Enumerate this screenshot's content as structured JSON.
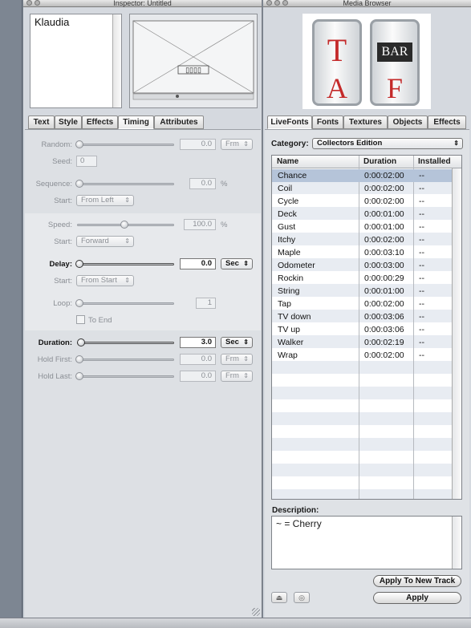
{
  "inspector": {
    "title": "Inspector: Untitled",
    "text_preview": "Klaudia",
    "tabs": [
      {
        "label": "Text",
        "active": false
      },
      {
        "label": "Style",
        "active": false
      },
      {
        "label": "Effects",
        "active": false
      },
      {
        "label": "Timing",
        "active": true
      },
      {
        "label": "Attributes",
        "active": false
      }
    ],
    "timing": {
      "random": {
        "label": "Random:",
        "value": "0.0",
        "unit": "Frm"
      },
      "seed": {
        "label": "Seed:",
        "value": "0"
      },
      "sequence": {
        "label": "Sequence:",
        "value": "0.0",
        "unit": "%"
      },
      "sequence_start": {
        "label": "Start:",
        "value": "From Left"
      },
      "speed": {
        "label": "Speed:",
        "value": "100.0",
        "unit": "%"
      },
      "speed_start": {
        "label": "Start:",
        "value": "Forward"
      },
      "delay": {
        "label": "Delay:",
        "value": "0.0",
        "unit": "Sec"
      },
      "delay_start": {
        "label": "Start:",
        "value": "From Start"
      },
      "loop": {
        "label": "Loop:",
        "value": "1"
      },
      "to_end": {
        "label": "To End",
        "checked": false
      },
      "duration": {
        "label": "Duration:",
        "value": "3.0",
        "unit": "Sec"
      },
      "hold_first": {
        "label": "Hold First:",
        "value": "0.0",
        "unit": "Frm"
      },
      "hold_last": {
        "label": "Hold Last:",
        "value": "0.0",
        "unit": "Frm"
      }
    }
  },
  "media_browser": {
    "title": "Media Browser",
    "preview_letters": {
      "top_left": "T",
      "top_right": "BAR",
      "bottom_left": "A",
      "bottom_right": "F"
    },
    "tabs": [
      {
        "label": "LiveFonts",
        "active": true
      },
      {
        "label": "Fonts",
        "active": false
      },
      {
        "label": "Textures",
        "active": false
      },
      {
        "label": "Objects",
        "active": false
      },
      {
        "label": "Effects",
        "active": false
      }
    ],
    "category_label": "Category:",
    "category_value": "Collectors Edition",
    "columns": [
      "Name",
      "Duration",
      "Installed"
    ],
    "rows": [
      {
        "name": "Chance",
        "duration": "0:00:02:00",
        "installed": "--",
        "selected": true
      },
      {
        "name": "Coil",
        "duration": "0:00:02:00",
        "installed": "--"
      },
      {
        "name": "Cycle",
        "duration": "0:00:02:00",
        "installed": "--"
      },
      {
        "name": "Deck",
        "duration": "0:00:01:00",
        "installed": "--"
      },
      {
        "name": "Gust",
        "duration": "0:00:01:00",
        "installed": "--"
      },
      {
        "name": "Itchy",
        "duration": "0:00:02:00",
        "installed": "--"
      },
      {
        "name": "Maple",
        "duration": "0:00:03:10",
        "installed": "--"
      },
      {
        "name": "Odometer",
        "duration": "0:00:03:00",
        "installed": "--"
      },
      {
        "name": "Rockin",
        "duration": "0:00:00:29",
        "installed": "--"
      },
      {
        "name": "String",
        "duration": "0:00:01:00",
        "installed": "--"
      },
      {
        "name": "Tap",
        "duration": "0:00:02:00",
        "installed": "--"
      },
      {
        "name": "TV down",
        "duration": "0:00:03:06",
        "installed": "--"
      },
      {
        "name": "TV up",
        "duration": "0:00:03:06",
        "installed": "--"
      },
      {
        "name": "Walker",
        "duration": "0:00:02:19",
        "installed": "--"
      },
      {
        "name": "Wrap",
        "duration": "0:00:02:00",
        "installed": "--"
      }
    ],
    "description_label": "Description:",
    "description_text": "~ = Cherry",
    "apply_new_track_label": "Apply To New Track",
    "apply_label": "Apply"
  }
}
